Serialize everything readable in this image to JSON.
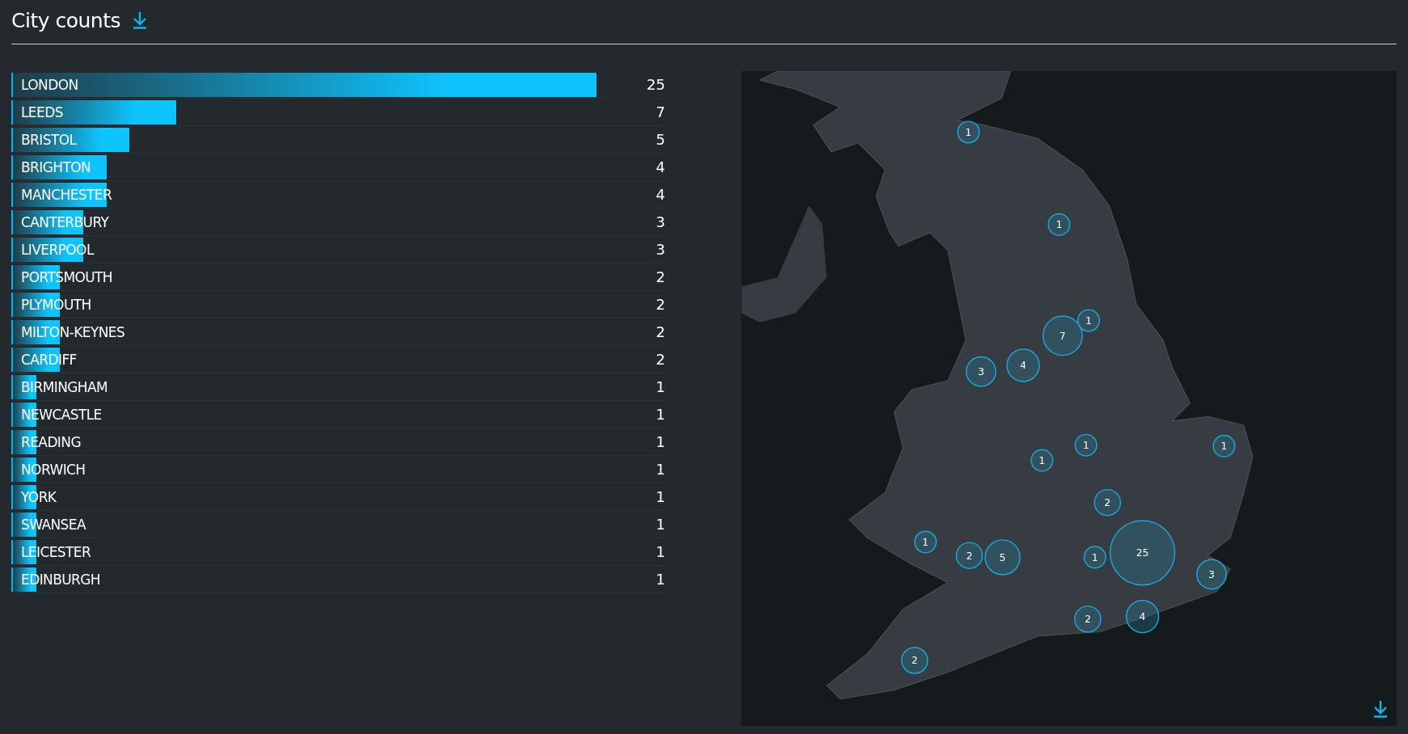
{
  "title": "City counts",
  "cities": [
    {
      "name": "LONDON",
      "count": "25",
      "level": 1
    },
    {
      "name": "LEEDS",
      "count": "7",
      "level": 0.28
    },
    {
      "name": "BRISTOL",
      "count": "5",
      "level": 0.2
    },
    {
      "name": "BRIGHTON",
      "count": "4",
      "level": 0.16
    },
    {
      "name": "MANCHESTER",
      "count": "4",
      "level": 0.16
    },
    {
      "name": "CANTERBURY",
      "count": "3",
      "level": 0.12
    },
    {
      "name": "LIVERPOOL",
      "count": "3",
      "level": 0.12
    },
    {
      "name": "PORTSMOUTH",
      "count": "2",
      "level": 0.08
    },
    {
      "name": "PLYMOUTH",
      "count": "2",
      "level": 0.08
    },
    {
      "name": "MILTON-KEYNES",
      "count": "2",
      "level": 0.08
    },
    {
      "name": "CARDIFF",
      "count": "2",
      "level": 0.08
    },
    {
      "name": "BIRMINGHAM",
      "count": "1",
      "level": 0.04
    },
    {
      "name": "NEWCASTLE",
      "count": "1",
      "level": 0.04
    },
    {
      "name": "READING",
      "count": "1",
      "level": 0.04
    },
    {
      "name": "NORWICH",
      "count": "1",
      "level": 0.04
    },
    {
      "name": "YORK",
      "count": "1",
      "level": 0.04
    },
    {
      "name": "SWANSEA",
      "count": "1",
      "level": 0.04
    },
    {
      "name": "LEICESTER",
      "count": "1",
      "level": 0.04
    },
    {
      "name": "EDINBURGH",
      "count": "1",
      "level": 0.04
    }
  ],
  "map": {
    "markers": [
      {
        "label": "1"
      },
      {
        "label": "1"
      },
      {
        "label": "1"
      },
      {
        "label": "7"
      },
      {
        "label": "4"
      },
      {
        "label": "3"
      },
      {
        "label": "1"
      },
      {
        "label": "1"
      },
      {
        "label": "1"
      },
      {
        "label": "2"
      },
      {
        "label": "1"
      },
      {
        "label": "2"
      },
      {
        "label": "5"
      },
      {
        "label": "1"
      },
      {
        "label": "25"
      },
      {
        "label": "3"
      },
      {
        "label": "2"
      },
      {
        "label": "4"
      },
      {
        "label": "2"
      }
    ]
  }
}
